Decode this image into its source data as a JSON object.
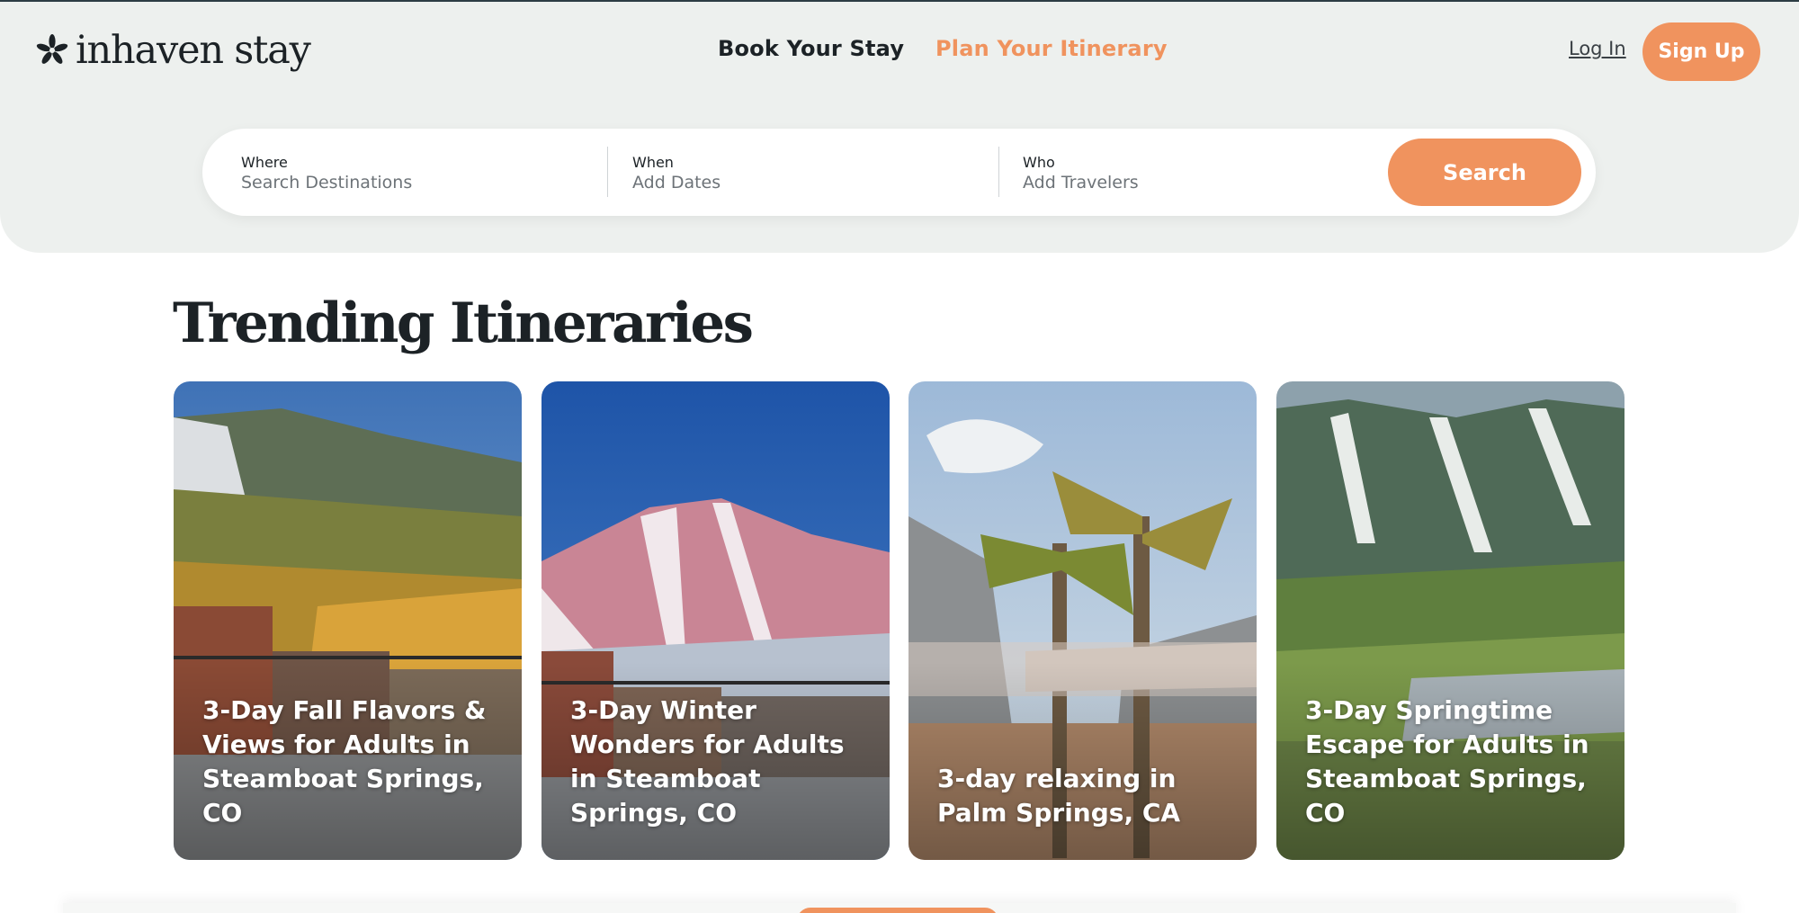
{
  "header": {
    "logo_text": "inhaven stay",
    "logo_icon": "flower-icon",
    "nav": {
      "book": "Book Your Stay",
      "plan": "Plan Your Itinerary"
    },
    "login": "Log In",
    "signup": "Sign Up"
  },
  "search": {
    "where": {
      "label": "Where",
      "placeholder": "Search Destinations"
    },
    "when": {
      "label": "When",
      "placeholder": "Add Dates"
    },
    "who": {
      "label": "Who",
      "placeholder": "Add Travelers"
    },
    "button": "Search"
  },
  "trending": {
    "title": "Trending Itineraries",
    "cards": [
      {
        "title": "3-Day Fall Flavors & Views for Adults in Steamboat Springs, CO"
      },
      {
        "title": "3-Day Winter Wonders for Adults in Steamboat Springs, CO"
      },
      {
        "title": "3-day relaxing in Palm Springs, CA"
      },
      {
        "title": "3-Day Springtime Escape for Adults in Steamboat Springs, CO"
      }
    ]
  },
  "colors": {
    "accent": "#f0935e",
    "header_bg": "#edf0ee",
    "text": "#1c2226"
  }
}
